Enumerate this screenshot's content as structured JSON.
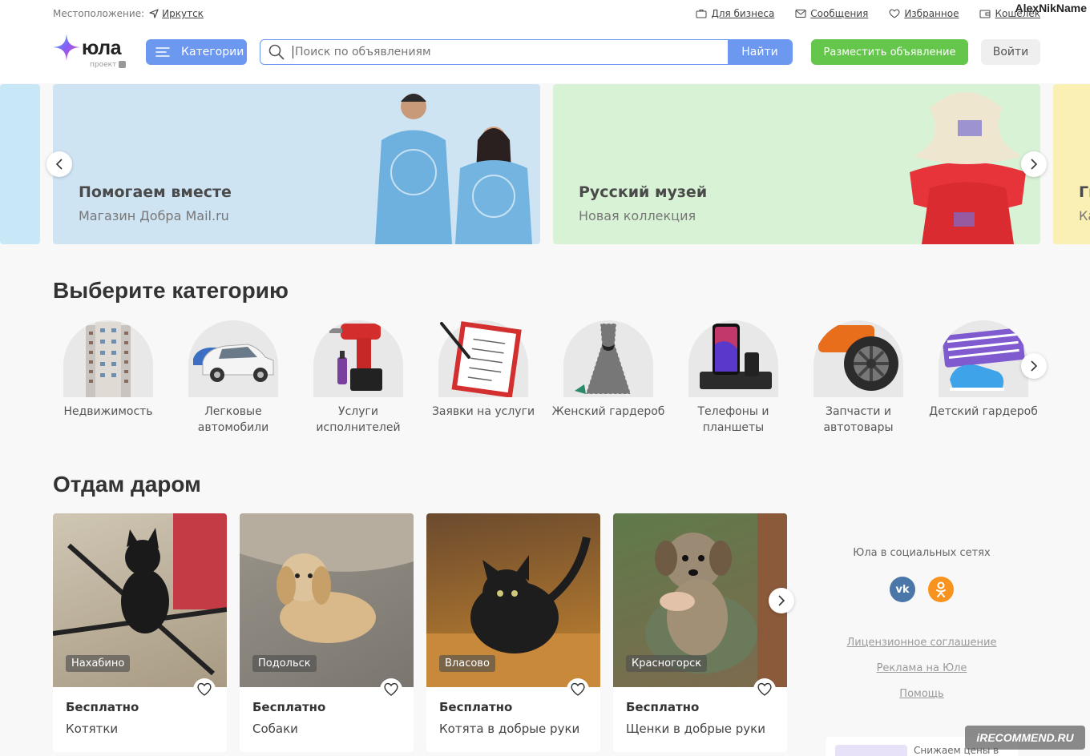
{
  "header": {
    "location_label": "Местоположение:",
    "location_city": "Иркутск",
    "links": [
      "Для бизнеса",
      "Сообщения",
      "Избранное",
      "Кошелёк"
    ],
    "username": "AlexNikName",
    "logo_text": "юла",
    "logo_sub": "проект",
    "categories_button": "Категории",
    "search_placeholder": "Поиск по объявлениям",
    "search_button": "Найти",
    "post_button": "Разместить объявление",
    "login_button": "Войти",
    "colors": {
      "accent": "#6c98f0",
      "post": "#64c74b"
    }
  },
  "banners": [
    {
      "title": "Помогаем вместе",
      "subtitle": "Магазин Добра Mail.ru"
    },
    {
      "title": "Русский музей",
      "subtitle": "Новая коллекция"
    },
    {
      "title": "Ги",
      "subtitle": "Ка"
    }
  ],
  "categories": {
    "heading": "Выберите категорию",
    "items": [
      {
        "label": "Недвижимость",
        "icon": "building-icon"
      },
      {
        "label": "Легковые автомобили",
        "icon": "cars-icon"
      },
      {
        "label": "Услуги исполнителей",
        "icon": "drill-icon"
      },
      {
        "label": "Заявки на услуги",
        "icon": "clipboard-icon"
      },
      {
        "label": "Женский гардероб",
        "icon": "dress-icon"
      },
      {
        "label": "Телефоны и планшеты",
        "icon": "phone-icon"
      },
      {
        "label": "Запчасти и автотовары",
        "icon": "wheel-icon"
      },
      {
        "label": "Детский гардероб",
        "icon": "sneakers-icon"
      }
    ]
  },
  "free": {
    "heading": "Отдам даром",
    "items": [
      {
        "city": "Нахабино",
        "price": "Бесплатно",
        "title": "Котятки"
      },
      {
        "city": "Подольск",
        "price": "Бесплатно",
        "title": "Собаки"
      },
      {
        "city": "Власово",
        "price": "Бесплатно",
        "title": "Котята в добрые руки"
      },
      {
        "city": "Красногорск",
        "price": "Бесплатно",
        "title": "Щенки в добрые руки"
      }
    ]
  },
  "sidebar": {
    "social_title": "Юла в социальных сетях",
    "social": [
      {
        "name": "vk",
        "label": "vk",
        "color": "#4a76a8"
      },
      {
        "name": "ok",
        "label": "ok",
        "color": "#f7931e"
      }
    ],
    "links": [
      "Лицензионное соглашение",
      "Реклама на Юле",
      "Помощь"
    ],
    "promo_text": "Снижаем цены в"
  },
  "watermark": "iRECOMMEND.RU"
}
